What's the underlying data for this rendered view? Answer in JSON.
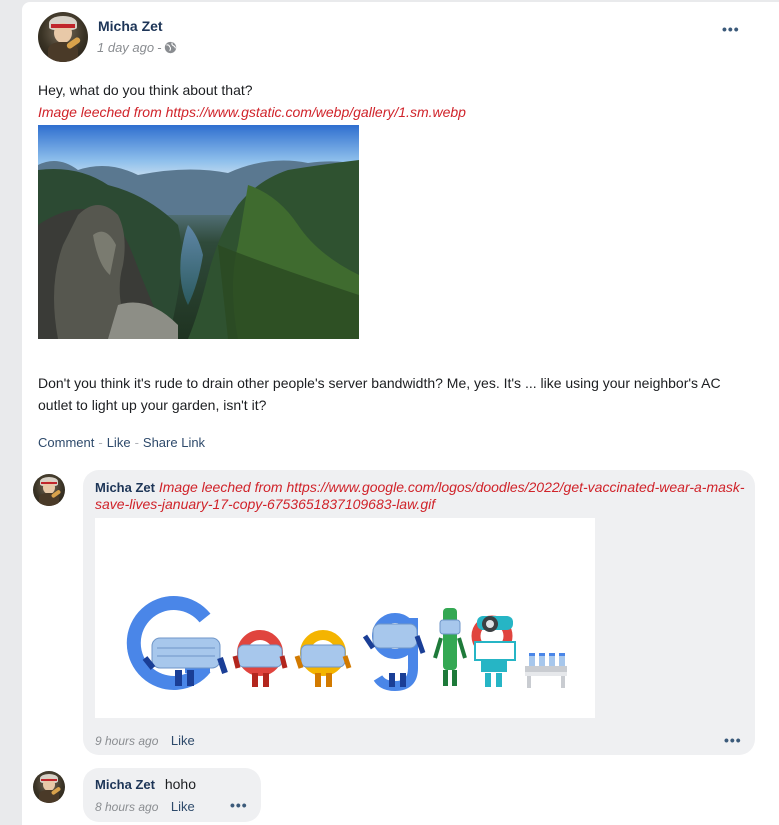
{
  "post": {
    "author": "Micha Zet",
    "time": "1 day ago",
    "time_separator": "-",
    "text_line1": "Hey, what do you think about that?",
    "leech_notice": "Image leeched from https://www.gstatic.com/webp/gallery/1.sm.webp",
    "text_body": "Don't you think it's rude to drain other people's server bandwidth? Me, yes. It's ... like using your neighbor's AC outlet to light up your garden, isn't it?",
    "actions": {
      "comment": "Comment",
      "like": "Like",
      "share": "Share Link",
      "separator": "-"
    },
    "more": "•••"
  },
  "comments": [
    {
      "author": "Micha Zet",
      "leech_notice": "Image leeched from https://www.google.com/logos/doodles/2022/get-vaccinated-wear-a-mask-save-lives-january-17-copy-6753651837109683-law.gif",
      "time": "9 hours ago",
      "like": "Like",
      "more": "•••"
    },
    {
      "author": "Micha Zet",
      "text": "hoho",
      "time": "8 hours ago",
      "like": "Like",
      "more": "•••"
    }
  ],
  "colors": {
    "google_blue": "#4a86e8",
    "google_red": "#e0443e",
    "google_yellow": "#f4b400",
    "google_green": "#34a853",
    "mask": "#a7c7ec",
    "leech_red": "#d0232a"
  },
  "icons": [
    "globe-icon",
    "more-icon",
    "avatar"
  ]
}
